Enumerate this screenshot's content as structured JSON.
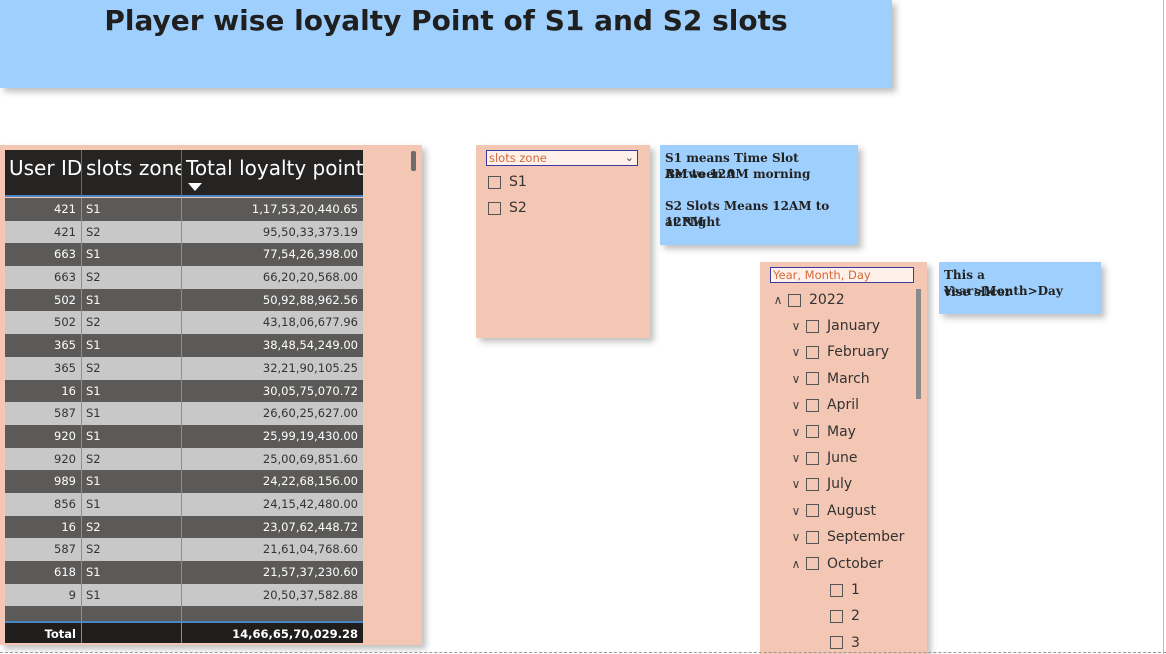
{
  "title": "Player wise loyalty Point of S1 and S2 slots",
  "table": {
    "columns": [
      "User ID",
      "slots zone",
      "Total loyalty points"
    ],
    "rows": [
      [
        "421",
        "S1",
        "1,17,53,20,440.65"
      ],
      [
        "421",
        "S2",
        "95,50,33,373.19"
      ],
      [
        "663",
        "S1",
        "77,54,26,398.00"
      ],
      [
        "663",
        "S2",
        "66,20,20,568.00"
      ],
      [
        "502",
        "S1",
        "50,92,88,962.56"
      ],
      [
        "502",
        "S2",
        "43,18,06,677.96"
      ],
      [
        "365",
        "S1",
        "38,48,54,249.00"
      ],
      [
        "365",
        "S2",
        "32,21,90,105.25"
      ],
      [
        "16",
        "S1",
        "30,05,75,070.72"
      ],
      [
        "587",
        "S1",
        "26,60,25,627.00"
      ],
      [
        "920",
        "S1",
        "25,99,19,430.00"
      ],
      [
        "920",
        "S2",
        "25,00,69,851.60"
      ],
      [
        "989",
        "S1",
        "24,22,68,156.00"
      ],
      [
        "856",
        "S1",
        "24,15,42,480.00"
      ],
      [
        "16",
        "S2",
        "23,07,62,448.72"
      ],
      [
        "587",
        "S2",
        "21,61,04,768.60"
      ],
      [
        "618",
        "S1",
        "21,57,37,230.60"
      ],
      [
        "9",
        "S1",
        "20,50,37,582.88"
      ],
      [
        "",
        "",
        ""
      ]
    ],
    "total_label": "Total",
    "total_value": "14,66,65,70,029.28"
  },
  "slot_slicer": {
    "header": "slots zone",
    "items": [
      "S1",
      "S2"
    ]
  },
  "note_slots": {
    "line1": "S1 means Time Slot Between 0",
    "line2": "AM to 12AM morning",
    "line3": "S2 Slots Means 12AM to 12PM",
    "line4": "at Night"
  },
  "date_slicer": {
    "header": "Year, Month, Day",
    "year": "2022",
    "months": [
      "January",
      "February",
      "March",
      "April",
      "May",
      "June",
      "July",
      "August",
      "September",
      "October"
    ],
    "days": [
      "1",
      "2",
      "3"
    ]
  },
  "note_date": {
    "line1": "This a Year>Month>Day",
    "line2": "vise slicer"
  },
  "colors": {
    "banner": "#9fcffd",
    "panel": "#f4c6b4",
    "table_header": "#252423",
    "row_dark": "#5b5a58",
    "row_light": "#c8c8c8"
  }
}
